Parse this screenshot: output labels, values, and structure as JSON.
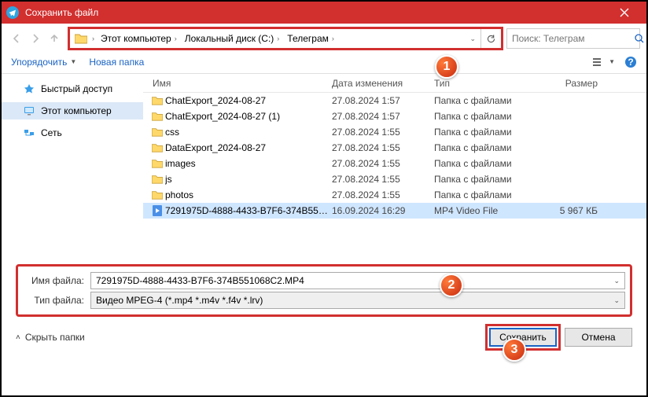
{
  "window": {
    "title": "Сохранить файл"
  },
  "breadcrumb": {
    "items": [
      "Этот компьютер",
      "Локальный диск (C:)",
      "Телеграм"
    ]
  },
  "search": {
    "placeholder": "Поиск: Телеграм"
  },
  "toolbar": {
    "organize": "Упорядочить",
    "newfolder": "Новая папка"
  },
  "sidebar": {
    "items": [
      {
        "label": "Быстрый доступ"
      },
      {
        "label": "Этот компьютер"
      },
      {
        "label": "Сеть"
      }
    ]
  },
  "columns": {
    "name": "Имя",
    "date": "Дата изменения",
    "type": "Тип",
    "size": "Размер"
  },
  "rows": [
    {
      "name": "ChatExport_2024-08-27",
      "date": "27.08.2024 1:57",
      "type": "Папка с файлами",
      "size": "",
      "kind": "folder"
    },
    {
      "name": "ChatExport_2024-08-27 (1)",
      "date": "27.08.2024 1:57",
      "type": "Папка с файлами",
      "size": "",
      "kind": "folder"
    },
    {
      "name": "css",
      "date": "27.08.2024 1:55",
      "type": "Папка с файлами",
      "size": "",
      "kind": "folder"
    },
    {
      "name": "DataExport_2024-08-27",
      "date": "27.08.2024 1:55",
      "type": "Папка с файлами",
      "size": "",
      "kind": "folder"
    },
    {
      "name": "images",
      "date": "27.08.2024 1:55",
      "type": "Папка с файлами",
      "size": "",
      "kind": "folder"
    },
    {
      "name": "js",
      "date": "27.08.2024 1:55",
      "type": "Папка с файлами",
      "size": "",
      "kind": "folder"
    },
    {
      "name": "photos",
      "date": "27.08.2024 1:55",
      "type": "Папка с файлами",
      "size": "",
      "kind": "folder"
    },
    {
      "name": "7291975D-4888-4433-B7F6-374B551068C...",
      "date": "16.09.2024 16:29",
      "type": "MP4 Video File",
      "size": "5 967 КБ",
      "kind": "mp4",
      "selected": true
    }
  ],
  "fields": {
    "name_label": "Имя файла:",
    "name_value": "7291975D-4888-4433-B7F6-374B551068C2.MP4",
    "type_label": "Тип файла:",
    "type_value": "Видео MPEG-4 (*.mp4 *.m4v *.f4v *.lrv)"
  },
  "footer": {
    "hide_folders": "Скрыть папки",
    "save": "Сохранить",
    "cancel": "Отмена"
  },
  "badges": {
    "b1": "1",
    "b2": "2",
    "b3": "3"
  }
}
